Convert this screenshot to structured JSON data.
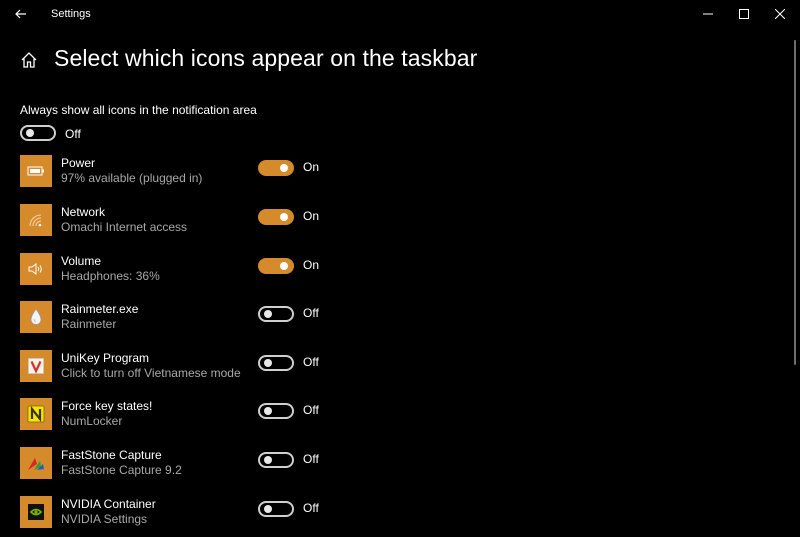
{
  "window": {
    "app_title": "Settings",
    "page_title": "Select which icons appear on the taskbar"
  },
  "always_show": {
    "label": "Always show all icons in the notification area",
    "state": "Off",
    "on": false
  },
  "accent_color": "#d58a2b",
  "items": [
    {
      "name": "Power",
      "desc": "97% available (plugged in)",
      "state": "On",
      "on": true,
      "icon": "battery-icon"
    },
    {
      "name": "Network",
      "desc": "Omachi Internet access",
      "state": "On",
      "on": true,
      "icon": "wifi-icon"
    },
    {
      "name": "Volume",
      "desc": "Headphones: 36%",
      "state": "On",
      "on": true,
      "icon": "speaker-icon"
    },
    {
      "name": "Rainmeter.exe",
      "desc": "Rainmeter",
      "state": "Off",
      "on": false,
      "icon": "rainmeter-drop-icon"
    },
    {
      "name": "UniKey Program",
      "desc": "Click to turn off Vietnamese mode",
      "state": "Off",
      "on": false,
      "icon": "unikey-v-icon"
    },
    {
      "name": "Force key states!",
      "desc": "NumLocker",
      "state": "Off",
      "on": false,
      "icon": "numlocker-n-icon"
    },
    {
      "name": "FastStone Capture",
      "desc": "FastStone Capture 9.2",
      "state": "Off",
      "on": false,
      "icon": "faststone-capture-icon"
    },
    {
      "name": "NVIDIA Container",
      "desc": "NVIDIA Settings",
      "state": "Off",
      "on": false,
      "icon": "nvidia-icon"
    }
  ]
}
